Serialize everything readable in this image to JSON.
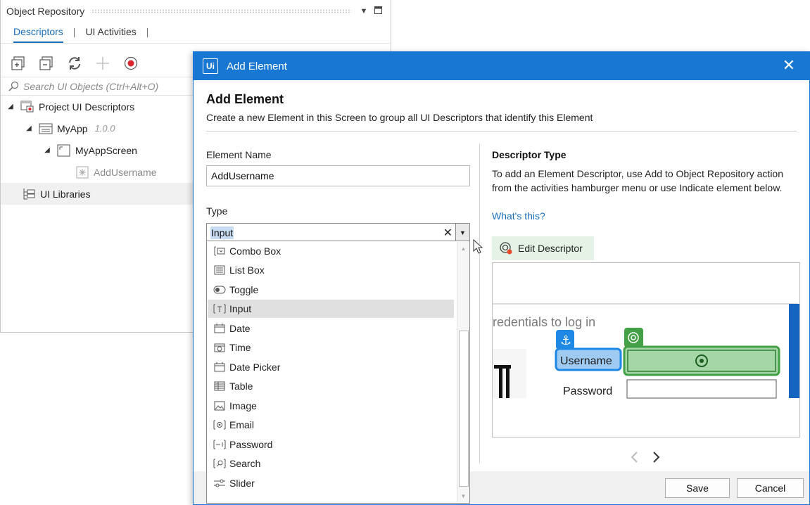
{
  "repo": {
    "title": "Object Repository",
    "tabs": [
      {
        "label": "Descriptors",
        "active": true
      },
      {
        "label": "UI Activities",
        "active": false
      }
    ],
    "tab_sep": "|",
    "search_placeholder": "Search UI Objects (Ctrl+Alt+O)",
    "tree": {
      "project": "Project UI Descriptors",
      "app": "MyApp",
      "app_version": "1.0.0",
      "screen": "MyAppScreen",
      "element": "AddUsername",
      "libraries": "UI Libraries"
    }
  },
  "dialog": {
    "logo": "Ui",
    "window_title": "Add Element",
    "heading": "Add Element",
    "description": "Create a new Element in this Screen to group all UI Descriptors that identify this Element",
    "element_name_label": "Element Name",
    "element_name_value": "AddUsername",
    "type_label": "Type",
    "type_value": "Input",
    "descriptor_type_title": "Descriptor Type",
    "descriptor_type_text": "To add an Element Descriptor, use Add to Object Repository action from the activities hamburger menu or use Indicate element below.",
    "whats_this": "What's this?",
    "edit_descriptor": "Edit Descriptor",
    "save": "Save",
    "cancel": "Cancel",
    "preview": {
      "text_fragment": "redentials to log in",
      "username_label": "Username",
      "password_label": "Password"
    }
  },
  "dropdown": {
    "items": [
      {
        "label": "Combo Box",
        "icon": "combo-box-icon"
      },
      {
        "label": "List Box",
        "icon": "list-box-icon"
      },
      {
        "label": "Toggle",
        "icon": "toggle-icon"
      },
      {
        "label": "Input",
        "icon": "input-icon",
        "highlighted": true
      },
      {
        "label": "Date",
        "icon": "calendar-icon"
      },
      {
        "label": "Time",
        "icon": "clock-calendar-icon"
      },
      {
        "label": "Date Picker",
        "icon": "calendar-icon"
      },
      {
        "label": "Table",
        "icon": "table-icon"
      },
      {
        "label": "Image",
        "icon": "image-icon"
      },
      {
        "label": "Email",
        "icon": "email-icon"
      },
      {
        "label": "Password",
        "icon": "password-icon"
      },
      {
        "label": "Search",
        "icon": "search-field-icon"
      },
      {
        "label": "Slider",
        "icon": "slider-icon"
      }
    ]
  },
  "colors": {
    "accent": "#1877d2",
    "link": "#1a6fb8",
    "highlight_green": "#4caf50",
    "edit_descriptor_bg": "#e4f3e6"
  }
}
